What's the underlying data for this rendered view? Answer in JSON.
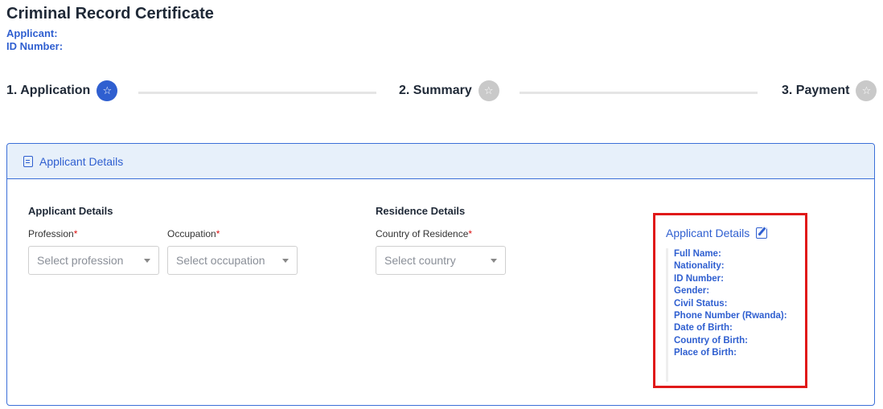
{
  "header": {
    "title": "Criminal Record Certificate",
    "applicant_label": "Applicant:",
    "id_number_label": "ID Number:"
  },
  "stepper": {
    "steps": [
      {
        "label": "1. Application",
        "state": "active"
      },
      {
        "label": "2. Summary",
        "state": "inactive"
      },
      {
        "label": "3. Payment",
        "state": "inactive"
      }
    ],
    "icon": "star-icon",
    "active_color": "#2f5fd0",
    "inactive_color": "#c9c9c9"
  },
  "card": {
    "header_label": "Applicant Details",
    "header_icon": "document-icon",
    "accent_color": "#3b6fd8",
    "applicant_section": {
      "title": "Applicant Details",
      "profession": {
        "label": "Profession",
        "required": "*",
        "placeholder": "Select profession"
      },
      "occupation": {
        "label": "Occupation",
        "required": "*",
        "placeholder": "Select occupation"
      }
    },
    "residence_section": {
      "title": "Residence Details",
      "country": {
        "label": "Country of Residence",
        "required": "*",
        "placeholder": "Select country"
      }
    },
    "details_panel": {
      "title": "Applicant Details",
      "edit_icon": "edit-icon",
      "highlight_color": "#e01919",
      "fields": [
        "Full Name:",
        "Nationality:",
        "ID Number:",
        "Gender:",
        "Civil Status:",
        "Phone Number (Rwanda):",
        "Date of Birth:",
        "Country of Birth:",
        "Place of Birth:"
      ]
    }
  }
}
